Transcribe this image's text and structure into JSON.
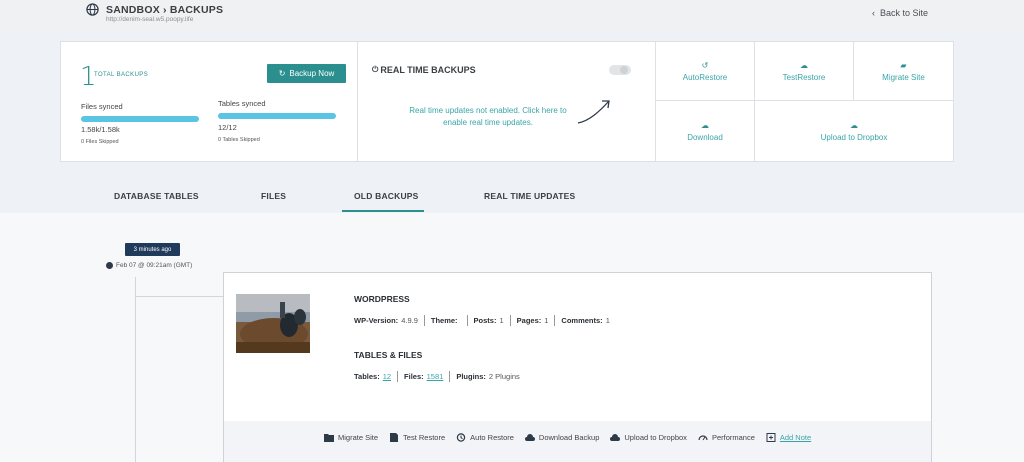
{
  "header": {
    "title": "SANDBOX › BACKUPS",
    "url": "http://denim-seal.w5.poopy.life",
    "back_label": "Back to Site"
  },
  "summary": {
    "total_count": "1",
    "total_label": "TOTAL BACKUPS",
    "backup_now": "Backup Now",
    "files_label": "Files synced",
    "files_value": "1.58k/1.58k",
    "files_progress": 1.0,
    "files_skipped": "0 Files Skipped",
    "tables_label": "Tables synced",
    "tables_value": "12/12",
    "tables_progress": 1.0,
    "tables_skipped": "0 Tables Skipped"
  },
  "realtime": {
    "title": "REAL TIME BACKUPS",
    "enabled": false,
    "message": "Real time updates not enabled. Click here to enable real time updates."
  },
  "actions": {
    "auto_restore": "AutoRestore",
    "test_restore": "TestRestore",
    "migrate_site": "Migrate Site",
    "download": "Download",
    "upload_dropbox": "Upload to Dropbox"
  },
  "tabs": [
    {
      "label": "DATABASE TABLES"
    },
    {
      "label": "FILES"
    },
    {
      "label": "OLD BACKUPS",
      "active": true
    },
    {
      "label": "REAL TIME UPDATES"
    }
  ],
  "timeline": {
    "ago": "3 minutes ago",
    "date": "Feb 07 @ 09:21am (GMT)"
  },
  "backup": {
    "wp_title": "WORDPRESS",
    "wp_version_label": "WP-Version:",
    "wp_version": "4.9.9",
    "theme_label": "Theme:",
    "theme": "",
    "posts_label": "Posts:",
    "posts": "1",
    "pages_label": "Pages:",
    "pages": "1",
    "comments_label": "Comments:",
    "comments": "1",
    "tf_title": "TABLES & FILES",
    "tables_label": "Tables:",
    "tables": "12",
    "files_label": "Files:",
    "files": "1581",
    "plugins_label": "Plugins:",
    "plugins": "2 Plugins"
  },
  "footer_actions": {
    "migrate": "Migrate Site",
    "test_restore": "Test Restore",
    "auto_restore": "Auto Restore",
    "download": "Download Backup",
    "upload": "Upload to Dropbox",
    "performance": "Performance",
    "add_note": "Add Note"
  },
  "colors": {
    "accent": "#2c8f8f",
    "link": "#3aa5a8",
    "progress": "#5bc3e3",
    "badge": "#1f3a5a"
  }
}
